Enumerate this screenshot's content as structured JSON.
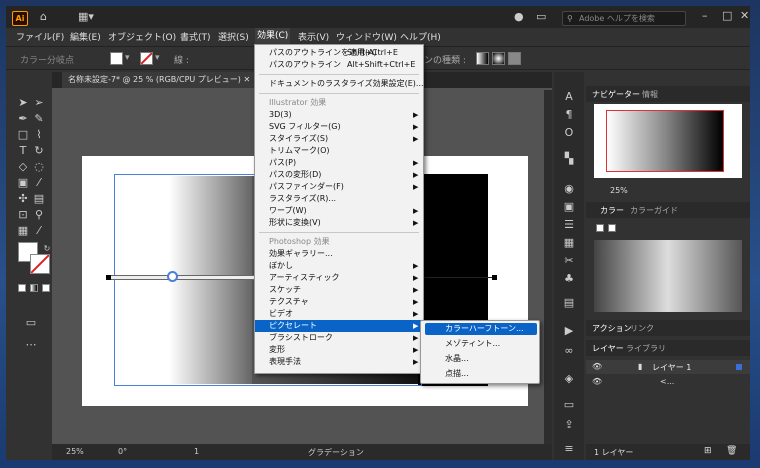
{
  "app": {
    "logo": "Ai",
    "search_placeholder": "Adobe ヘルプを検索"
  },
  "menubar": [
    "ファイル(F)",
    "編集(E)",
    "オブジェクト(O)",
    "書式(T)",
    "選択(S)",
    "効果(C)",
    "表示(V)",
    "ウィンドウ(W)",
    "ヘルプ(H)"
  ],
  "control_bar": {
    "label": "カラー分岐点",
    "stroke_label": "線 :",
    "right_label": "ンの種類 :"
  },
  "doc_tab": "名称未設定-7* @ 25 % (RGB/CPU プレビュー)",
  "effect_menu": {
    "items": [
      {
        "label": "パスのアウトラインを適用(A)",
        "shortcut": "Shift+Ctrl+E"
      },
      {
        "label": "パスのアウトライン",
        "shortcut": "Alt+Shift+Ctrl+E"
      },
      {
        "label": "ドキュメントのラスタライズ効果設定(E)..."
      },
      {
        "label": "Illustrator 効果",
        "header": true
      },
      {
        "label": "3D(3)",
        "sub": true
      },
      {
        "label": "SVG フィルター(G)",
        "sub": true
      },
      {
        "label": "スタイライズ(S)",
        "sub": true
      },
      {
        "label": "トリムマーク(O)"
      },
      {
        "label": "パス(P)",
        "sub": true
      },
      {
        "label": "パスの変形(D)",
        "sub": true
      },
      {
        "label": "パスファインダー(F)",
        "sub": true
      },
      {
        "label": "ラスタライズ(R)..."
      },
      {
        "label": "ワープ(W)",
        "sub": true
      },
      {
        "label": "形状に変換(V)",
        "sub": true
      },
      {
        "label": "Photoshop 効果",
        "header": true
      },
      {
        "label": "効果ギャラリー..."
      },
      {
        "label": "ぼかし",
        "sub": true
      },
      {
        "label": "アーティスティック",
        "sub": true
      },
      {
        "label": "スケッチ",
        "sub": true
      },
      {
        "label": "テクスチャ",
        "sub": true
      },
      {
        "label": "ビデオ",
        "sub": true
      },
      {
        "label": "ピクセレート",
        "sub": true,
        "selected": true
      },
      {
        "label": "ブラシストローク",
        "sub": true
      },
      {
        "label": "変形",
        "sub": true
      },
      {
        "label": "表現手法",
        "sub": true
      }
    ]
  },
  "pixelate_submenu": [
    "カラーハーフトーン...",
    "メゾティント...",
    "水晶...",
    "点描..."
  ],
  "navigator": {
    "tab1": "ナビゲーター",
    "tab2": "情報",
    "zoom": "25%"
  },
  "color_panel": {
    "tab1": "カラー",
    "tab2": "カラーガイド"
  },
  "actions_panel": {
    "tab1": "アクション",
    "tab2": "リンク"
  },
  "layers_panel": {
    "tab1": "レイヤー",
    "tab2": "ライブラリ",
    "layer_name": "レイヤー 1",
    "sublayer": "<...",
    "footer": "1 レイヤー"
  },
  "status": {
    "zoom": "25%",
    "angle": "0°",
    "artboard": "1",
    "tool": "グラデーション"
  },
  "colors": {
    "accent": "#0a64c8",
    "menu_bg": "#f2f2f2",
    "panel_bg": "#323232"
  }
}
